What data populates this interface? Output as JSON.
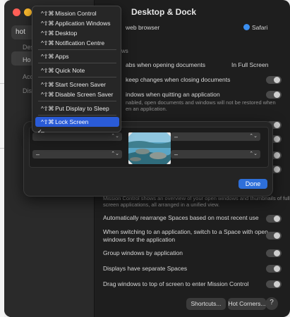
{
  "window": {
    "title": "Desktop & Dock"
  },
  "sidebar": {
    "search_value": "hot",
    "fragments": [
      "Des",
      "Ho",
      "Acc",
      "Dis"
    ]
  },
  "settings": {
    "default_browser_label": "web browser",
    "default_browser_value": "Safari",
    "section_label": "ws",
    "prefer_tabs_label": "abs when opening documents",
    "prefer_tabs_value": "In Full Screen",
    "ask_keep_label": "keep changes when closing documents",
    "close_windows_label": "indows when quitting an application",
    "close_windows_desc_1": "nabled, open documents and windows will not be restored when",
    "close_windows_desc_2": "en an application.",
    "mc_desc_1": "Mission Control shows an overview of your open windows and thumbnails of full-",
    "mc_desc_2": "screen applications, all arranged in a unified view.",
    "auto_rearrange": "Automatically rearrange Spaces based on most recent use",
    "switch_space_1": "When switching to an application, switch to a Space with open",
    "switch_space_2": "windows for the application",
    "group_windows": "Group windows by application",
    "separate_spaces": "Displays have separate Spaces",
    "drag_windows": "Drag windows to top of screen to enter Mission Control"
  },
  "buttons": {
    "shortcuts": "Shortcuts...",
    "hot_corners": "Hot Corners...",
    "help": "?",
    "done": "Done"
  },
  "hot_corners": {
    "top_left": "",
    "top_right": "–",
    "bottom_left": "–",
    "bottom_right": "–"
  },
  "menu": {
    "modifiers": "^⇧⌘",
    "items": [
      "Mission Control",
      "Application Windows",
      "Desktop",
      "Notification Centre",
      "Apps",
      "Quick Note",
      "Start Screen Saver",
      "Disable Screen Saver",
      "Put Display to Sleep",
      "Lock Screen",
      "–"
    ],
    "check": "✓"
  },
  "colors": {
    "accent": "#2a5bd7",
    "done": "#2e6fd9"
  }
}
